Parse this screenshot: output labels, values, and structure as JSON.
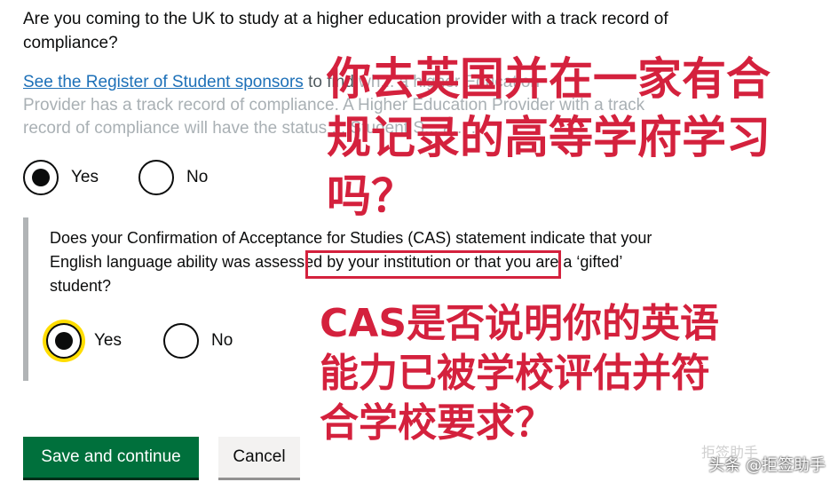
{
  "question1": {
    "text": "Are you coming to the UK to study at a higher education provider with a track record of compliance?",
    "hint_link": "See the Register of Student sponsors",
    "hint_line1_rest": " to find ",
    "hint_line1_tail": "wh... a higher Education",
    "hint_line2": "Provider has a track record of compliance. A Higher Education Provider with a track",
    "hint_line3": "record of compliance will have the status ... Student S... a... ...",
    "yes_label": "Yes",
    "no_label": "No",
    "selected": "Yes"
  },
  "question2": {
    "text_part1": "Does your Confirmation of Acceptance for Studies (CAS) statement indicate that your English language ability ",
    "text_highlight": "was assessed by your institution",
    "text_part2": " or that you are a ‘gifted’ student?",
    "yes_label": "Yes",
    "no_label": "No",
    "selected": "Yes"
  },
  "buttons": {
    "save": "Save and continue",
    "cancel": "Cancel"
  },
  "annotations": {
    "cn1": "你去英国并在一家有合规记录的高等学府学习吗？",
    "cn2": "CAS是否说明你的英语能力已被学校评估并符合学校要求？"
  },
  "watermark": {
    "main": "头条 @拒签助手",
    "faint": "拒签助手"
  },
  "colors": {
    "link": "#1d70b8",
    "primary_button": "#00703c",
    "annotation_red": "#d4213d",
    "focus_yellow": "#ffdd00"
  }
}
